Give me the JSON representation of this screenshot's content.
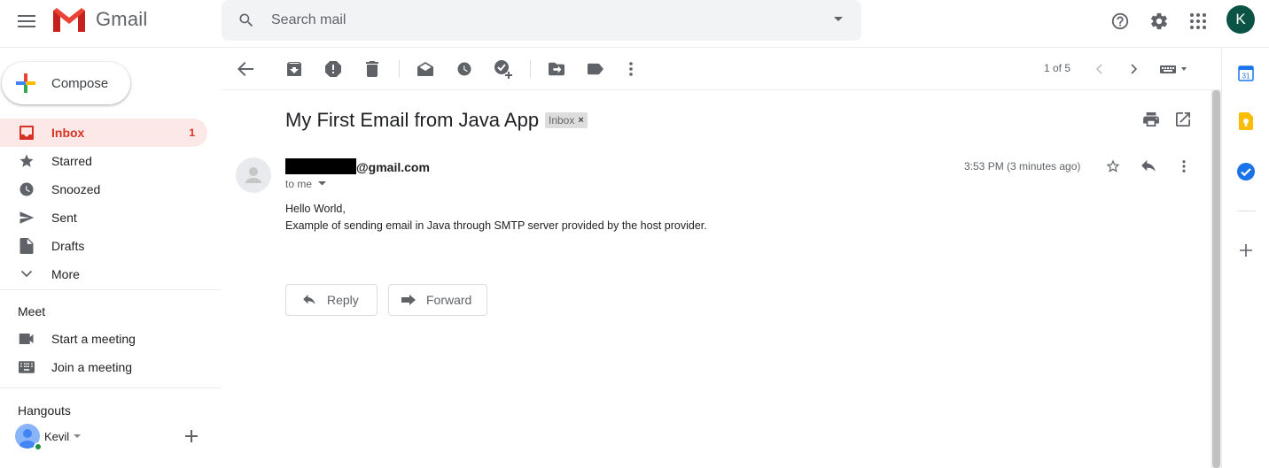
{
  "header": {
    "app_name": "Gmail",
    "search_placeholder": "Search mail",
    "avatar_initial": "K",
    "icons": [
      "menu-icon",
      "gmail-logo",
      "search-icon",
      "caret-down-icon",
      "help-icon",
      "settings-icon",
      "apps-grid-icon"
    ]
  },
  "sidebar": {
    "compose_label": "Compose",
    "items": [
      {
        "label": "Inbox",
        "icon": "inbox-icon",
        "count": "1",
        "active": true
      },
      {
        "label": "Starred",
        "icon": "star-icon"
      },
      {
        "label": "Snoozed",
        "icon": "clock-icon"
      },
      {
        "label": "Sent",
        "icon": "send-icon"
      },
      {
        "label": "Drafts",
        "icon": "draft-icon"
      },
      {
        "label": "More",
        "icon": "chevron-down-icon"
      }
    ],
    "meet": {
      "title": "Meet",
      "items": [
        {
          "label": "Start a meeting",
          "icon": "video-icon"
        },
        {
          "label": "Join a meeting",
          "icon": "keyboard-icon"
        }
      ]
    },
    "hangouts": {
      "title": "Hangouts",
      "user": "Kevil"
    }
  },
  "toolbar": {
    "pager": "1 of 5",
    "icons": [
      "back-arrow-icon",
      "archive-icon",
      "report-spam-icon",
      "delete-icon",
      "mark-unread-icon",
      "snooze-icon",
      "add-task-icon",
      "move-to-icon",
      "label-icon",
      "more-vert-icon",
      "prev-icon",
      "next-icon",
      "input-tools-icon"
    ]
  },
  "email": {
    "subject": "My First Email from Java App",
    "label_chip": "Inbox",
    "label_remove": "×",
    "sender_domain": "@gmail.com",
    "recipient": "to me",
    "timestamp": "3:53 PM (3 minutes ago)",
    "body": [
      "Hello World,",
      "Example of sending email in Java through SMTP server provided by the host provider."
    ],
    "reply_label": "Reply",
    "forward_label": "Forward"
  },
  "right_rail": {
    "icons": [
      "calendar-icon",
      "keep-icon",
      "tasks-icon",
      "add-addon-icon"
    ],
    "calendar_day": "31"
  },
  "colors": {
    "accent_red": "#d93025",
    "inbox_highlight": "#fce8e6",
    "avatar_bg": "#0b5345",
    "search_bg": "#f1f3f4"
  }
}
